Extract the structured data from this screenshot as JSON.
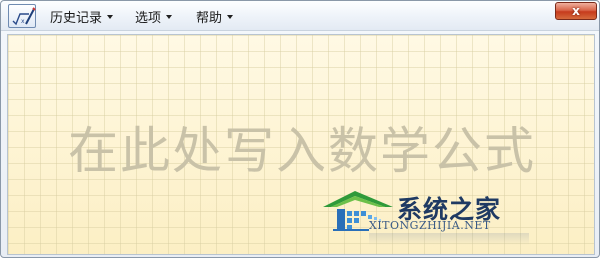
{
  "menubar": {
    "items": [
      {
        "label": "历史记录"
      },
      {
        "label": "选项"
      },
      {
        "label": "帮助"
      }
    ],
    "close_label": "x"
  },
  "write_area": {
    "placeholder": "在此处写入数学公式"
  },
  "watermark": {
    "title": "系统之家",
    "url": "XITONGZHIJIA.NET"
  },
  "colors": {
    "grid_background": "#fdf6d8",
    "placeholder_text": "#c9c2a8",
    "close_button": "#c63b1d",
    "watermark_blue": "#1f3a63"
  },
  "icons": [
    "math-input-app-icon",
    "chevron-down-icon",
    "close-icon",
    "house-logo-icon"
  ]
}
